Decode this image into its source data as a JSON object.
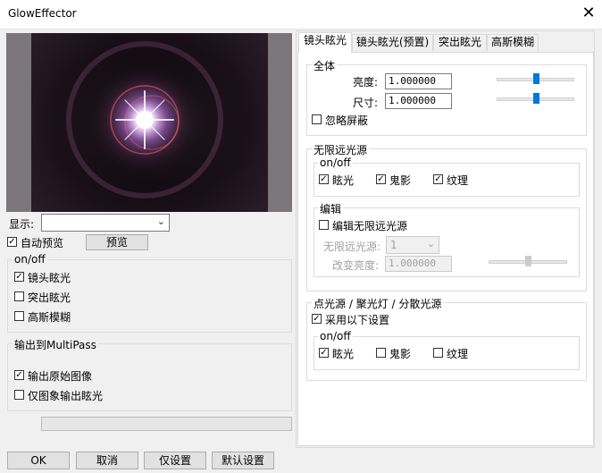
{
  "window": {
    "title": "GlowEffector",
    "close_glyph": "✕"
  },
  "left": {
    "display_label": "显示:",
    "display_value": "",
    "auto_preview_label": "自动预览",
    "auto_preview_checked": true,
    "preview_button": "预览",
    "onoff_group": {
      "title": "on/off",
      "items": [
        {
          "label": "镜头眩光",
          "checked": true
        },
        {
          "label": "突出眩光",
          "checked": false
        },
        {
          "label": "高斯模糊",
          "checked": false
        }
      ]
    },
    "multipass_group": {
      "title": "输出到MultiPass",
      "items": [
        {
          "label": "输出原始图像",
          "checked": true
        },
        {
          "label": "仅图象输出眩光",
          "checked": false
        }
      ]
    },
    "progress": 0
  },
  "buttons": {
    "ok": "OK",
    "cancel": "取消",
    "temp": "仅设置",
    "default": "默认设置"
  },
  "tabs": [
    "镜头眩光",
    "镜头眩光(预置)",
    "突出眩光",
    "高斯模糊"
  ],
  "active_tab": 0,
  "panel": {
    "global": {
      "title": "全体",
      "brightness_label": "亮度:",
      "brightness_value": "1.000000",
      "brightness_slider": 0.5,
      "size_label": "尺寸:",
      "size_value": "1.000000",
      "size_slider": 0.5,
      "ignore_mask_label": "忽略屏蔽",
      "ignore_mask_checked": false
    },
    "infinite": {
      "title": "无限远光源",
      "onoff_title": "on/off",
      "items": [
        {
          "label": "眩光",
          "checked": true
        },
        {
          "label": "鬼影",
          "checked": true
        },
        {
          "label": "纹理",
          "checked": true
        }
      ],
      "edit_title": "编辑",
      "edit_checkbox_label": "编辑无限远光源",
      "edit_checked": false,
      "source_label": "无限远光源:",
      "source_value": "1",
      "brightness_label": "改变亮度:",
      "brightness_value": "1.000000",
      "brightness_slider": 0.5
    },
    "point": {
      "title": "点光源 / 聚光灯 / 分散光源",
      "use_settings_label": "采用以下设置",
      "use_settings_checked": true,
      "onoff_title": "on/off",
      "items": [
        {
          "label": "眩光",
          "checked": true
        },
        {
          "label": "鬼影",
          "checked": false
        },
        {
          "label": "纹理",
          "checked": false
        }
      ]
    }
  },
  "colors": {
    "accent": "#0078d7",
    "flare_core": "#ffffff",
    "flare_halo": "#d78cff",
    "flare_ring": "#ff5a5a"
  }
}
